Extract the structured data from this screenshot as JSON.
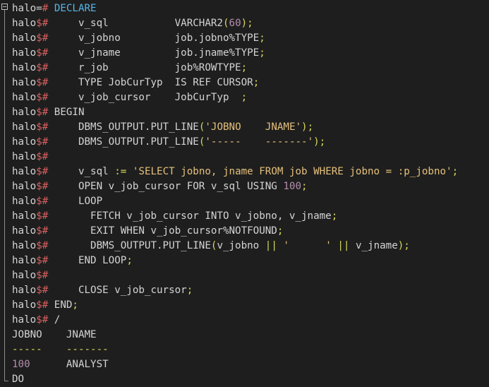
{
  "terminal": {
    "lines": [
      [
        {
          "t": "halo=",
          "c": "prompt"
        },
        {
          "t": "# ",
          "c": "sym"
        },
        {
          "t": "DECLARE",
          "c": "kw"
        }
      ],
      [
        {
          "t": "halo",
          "c": "prompt"
        },
        {
          "t": "$#",
          "c": "sym"
        },
        {
          "t": "     v_sql           VARCHAR2",
          "c": "plain"
        },
        {
          "t": "(",
          "c": "punct"
        },
        {
          "t": "60",
          "c": "num"
        },
        {
          "t": ");",
          "c": "punct"
        }
      ],
      [
        {
          "t": "halo",
          "c": "prompt"
        },
        {
          "t": "$#",
          "c": "sym"
        },
        {
          "t": "     v_jobno         job.jobno%TYPE",
          "c": "plain"
        },
        {
          "t": ";",
          "c": "punct"
        }
      ],
      [
        {
          "t": "halo",
          "c": "prompt"
        },
        {
          "t": "$#",
          "c": "sym"
        },
        {
          "t": "     v_jname         job.jname%TYPE",
          "c": "plain"
        },
        {
          "t": ";",
          "c": "punct"
        }
      ],
      [
        {
          "t": "halo",
          "c": "prompt"
        },
        {
          "t": "$#",
          "c": "sym"
        },
        {
          "t": "     r_job           job%ROWTYPE",
          "c": "plain"
        },
        {
          "t": ";",
          "c": "punct"
        }
      ],
      [
        {
          "t": "halo",
          "c": "prompt"
        },
        {
          "t": "$#",
          "c": "sym"
        },
        {
          "t": "     TYPE JobCurTyp  IS REF CURSOR",
          "c": "plain"
        },
        {
          "t": ";",
          "c": "punct"
        }
      ],
      [
        {
          "t": "halo",
          "c": "prompt"
        },
        {
          "t": "$#",
          "c": "sym"
        },
        {
          "t": "     v_job_cursor    JobCurTyp  ",
          "c": "plain"
        },
        {
          "t": ";",
          "c": "punct"
        }
      ],
      [
        {
          "t": "halo",
          "c": "prompt"
        },
        {
          "t": "$# ",
          "c": "sym"
        },
        {
          "t": "BEGIN",
          "c": "plain"
        }
      ],
      [
        {
          "t": "halo",
          "c": "prompt"
        },
        {
          "t": "$#",
          "c": "sym"
        },
        {
          "t": "     DBMS_OUTPUT.PUT_LINE",
          "c": "plain"
        },
        {
          "t": "(",
          "c": "punct"
        },
        {
          "t": "'JOBNO    JNAME'",
          "c": "str"
        },
        {
          "t": ");",
          "c": "punct"
        }
      ],
      [
        {
          "t": "halo",
          "c": "prompt"
        },
        {
          "t": "$#",
          "c": "sym"
        },
        {
          "t": "     DBMS_OUTPUT.PUT_LINE",
          "c": "plain"
        },
        {
          "t": "(",
          "c": "punct"
        },
        {
          "t": "'-----    -------'",
          "c": "str"
        },
        {
          "t": ");",
          "c": "punct"
        }
      ],
      [
        {
          "t": "halo",
          "c": "prompt"
        },
        {
          "t": "$#",
          "c": "sym"
        }
      ],
      [
        {
          "t": "halo",
          "c": "prompt"
        },
        {
          "t": "$#",
          "c": "sym"
        },
        {
          "t": "     v_sql ",
          "c": "plain"
        },
        {
          "t": ":=",
          "c": "op"
        },
        {
          "t": " ",
          "c": "plain"
        },
        {
          "t": "'SELECT jobno, jname FROM job WHERE jobno = :p_jobno'",
          "c": "str"
        },
        {
          "t": ";",
          "c": "punct"
        }
      ],
      [
        {
          "t": "halo",
          "c": "prompt"
        },
        {
          "t": "$#",
          "c": "sym"
        },
        {
          "t": "     OPEN v_job_cursor FOR v_sql USING ",
          "c": "plain"
        },
        {
          "t": "100",
          "c": "num"
        },
        {
          "t": ";",
          "c": "punct"
        }
      ],
      [
        {
          "t": "halo",
          "c": "prompt"
        },
        {
          "t": "$#",
          "c": "sym"
        },
        {
          "t": "     LOOP",
          "c": "plain"
        }
      ],
      [
        {
          "t": "halo",
          "c": "prompt"
        },
        {
          "t": "$#",
          "c": "sym"
        },
        {
          "t": "       FETCH v_job_cursor INTO v_jobno, v_jname",
          "c": "plain"
        },
        {
          "t": ";",
          "c": "punct"
        }
      ],
      [
        {
          "t": "halo",
          "c": "prompt"
        },
        {
          "t": "$#",
          "c": "sym"
        },
        {
          "t": "       EXIT WHEN v_job_cursor%NOTFOUND",
          "c": "plain"
        },
        {
          "t": ";",
          "c": "punct"
        }
      ],
      [
        {
          "t": "halo",
          "c": "prompt"
        },
        {
          "t": "$#",
          "c": "sym"
        },
        {
          "t": "       DBMS_OUTPUT.PUT_LINE",
          "c": "plain"
        },
        {
          "t": "(",
          "c": "punct"
        },
        {
          "t": "v_jobno ",
          "c": "plain"
        },
        {
          "t": "||",
          "c": "op"
        },
        {
          "t": " ",
          "c": "plain"
        },
        {
          "t": "'      '",
          "c": "str"
        },
        {
          "t": " ",
          "c": "plain"
        },
        {
          "t": "||",
          "c": "op"
        },
        {
          "t": " v_jname",
          "c": "plain"
        },
        {
          "t": ");",
          "c": "punct"
        }
      ],
      [
        {
          "t": "halo",
          "c": "prompt"
        },
        {
          "t": "$#",
          "c": "sym"
        },
        {
          "t": "     END LOOP",
          "c": "plain"
        },
        {
          "t": ";",
          "c": "punct"
        }
      ],
      [
        {
          "t": "halo",
          "c": "prompt"
        },
        {
          "t": "$#",
          "c": "sym"
        }
      ],
      [
        {
          "t": "halo",
          "c": "prompt"
        },
        {
          "t": "$#",
          "c": "sym"
        },
        {
          "t": "     CLOSE v_job_cursor",
          "c": "plain"
        },
        {
          "t": ";",
          "c": "punct"
        }
      ],
      [
        {
          "t": "halo",
          "c": "prompt"
        },
        {
          "t": "$# ",
          "c": "sym"
        },
        {
          "t": "END",
          "c": "plain"
        },
        {
          "t": ";",
          "c": "punct"
        }
      ],
      [
        {
          "t": "halo",
          "c": "prompt"
        },
        {
          "t": "$# ",
          "c": "sym"
        },
        {
          "t": "/",
          "c": "plain"
        }
      ],
      [
        {
          "t": "JOBNO    JNAME",
          "c": "plain"
        }
      ],
      [
        {
          "t": "-----    -------",
          "c": "op"
        }
      ],
      [
        {
          "t": "100",
          "c": "num"
        },
        {
          "t": "      ANALYST",
          "c": "plain"
        }
      ],
      [
        {
          "t": "DO",
          "c": "plain"
        }
      ]
    ]
  },
  "colors": {
    "background": "#1e1e1e",
    "plain": "#d4d4d4",
    "prompt_symbol": "#d75f5f",
    "keyword": "#56b6e8",
    "number": "#b48ead",
    "string": "#e5c07b",
    "operator": "#d7d75f"
  },
  "icons": {
    "fold": "collapse-minus-icon"
  }
}
